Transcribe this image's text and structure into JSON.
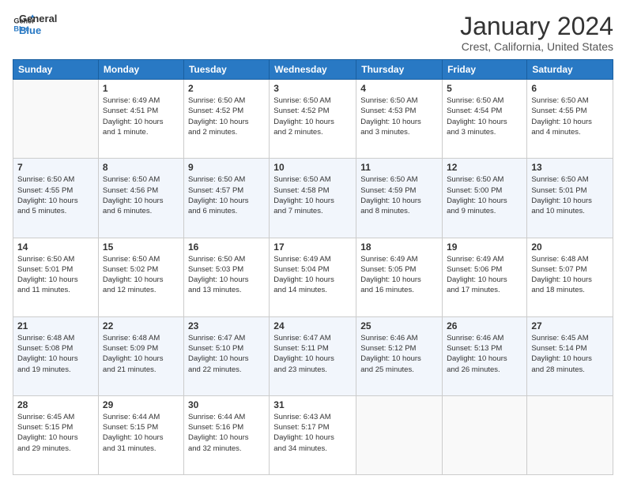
{
  "logo": {
    "line1": "General",
    "line2": "Blue"
  },
  "title": "January 2024",
  "location": "Crest, California, United States",
  "headers": [
    "Sunday",
    "Monday",
    "Tuesday",
    "Wednesday",
    "Thursday",
    "Friday",
    "Saturday"
  ],
  "rows": [
    [
      {
        "day": "",
        "info": ""
      },
      {
        "day": "1",
        "info": "Sunrise: 6:49 AM\nSunset: 4:51 PM\nDaylight: 10 hours\nand 1 minute."
      },
      {
        "day": "2",
        "info": "Sunrise: 6:50 AM\nSunset: 4:52 PM\nDaylight: 10 hours\nand 2 minutes."
      },
      {
        "day": "3",
        "info": "Sunrise: 6:50 AM\nSunset: 4:52 PM\nDaylight: 10 hours\nand 2 minutes."
      },
      {
        "day": "4",
        "info": "Sunrise: 6:50 AM\nSunset: 4:53 PM\nDaylight: 10 hours\nand 3 minutes."
      },
      {
        "day": "5",
        "info": "Sunrise: 6:50 AM\nSunset: 4:54 PM\nDaylight: 10 hours\nand 3 minutes."
      },
      {
        "day": "6",
        "info": "Sunrise: 6:50 AM\nSunset: 4:55 PM\nDaylight: 10 hours\nand 4 minutes."
      }
    ],
    [
      {
        "day": "7",
        "info": "Sunrise: 6:50 AM\nSunset: 4:55 PM\nDaylight: 10 hours\nand 5 minutes."
      },
      {
        "day": "8",
        "info": "Sunrise: 6:50 AM\nSunset: 4:56 PM\nDaylight: 10 hours\nand 6 minutes."
      },
      {
        "day": "9",
        "info": "Sunrise: 6:50 AM\nSunset: 4:57 PM\nDaylight: 10 hours\nand 6 minutes."
      },
      {
        "day": "10",
        "info": "Sunrise: 6:50 AM\nSunset: 4:58 PM\nDaylight: 10 hours\nand 7 minutes."
      },
      {
        "day": "11",
        "info": "Sunrise: 6:50 AM\nSunset: 4:59 PM\nDaylight: 10 hours\nand 8 minutes."
      },
      {
        "day": "12",
        "info": "Sunrise: 6:50 AM\nSunset: 5:00 PM\nDaylight: 10 hours\nand 9 minutes."
      },
      {
        "day": "13",
        "info": "Sunrise: 6:50 AM\nSunset: 5:01 PM\nDaylight: 10 hours\nand 10 minutes."
      }
    ],
    [
      {
        "day": "14",
        "info": "Sunrise: 6:50 AM\nSunset: 5:01 PM\nDaylight: 10 hours\nand 11 minutes."
      },
      {
        "day": "15",
        "info": "Sunrise: 6:50 AM\nSunset: 5:02 PM\nDaylight: 10 hours\nand 12 minutes."
      },
      {
        "day": "16",
        "info": "Sunrise: 6:50 AM\nSunset: 5:03 PM\nDaylight: 10 hours\nand 13 minutes."
      },
      {
        "day": "17",
        "info": "Sunrise: 6:49 AM\nSunset: 5:04 PM\nDaylight: 10 hours\nand 14 minutes."
      },
      {
        "day": "18",
        "info": "Sunrise: 6:49 AM\nSunset: 5:05 PM\nDaylight: 10 hours\nand 16 minutes."
      },
      {
        "day": "19",
        "info": "Sunrise: 6:49 AM\nSunset: 5:06 PM\nDaylight: 10 hours\nand 17 minutes."
      },
      {
        "day": "20",
        "info": "Sunrise: 6:48 AM\nSunset: 5:07 PM\nDaylight: 10 hours\nand 18 minutes."
      }
    ],
    [
      {
        "day": "21",
        "info": "Sunrise: 6:48 AM\nSunset: 5:08 PM\nDaylight: 10 hours\nand 19 minutes."
      },
      {
        "day": "22",
        "info": "Sunrise: 6:48 AM\nSunset: 5:09 PM\nDaylight: 10 hours\nand 21 minutes."
      },
      {
        "day": "23",
        "info": "Sunrise: 6:47 AM\nSunset: 5:10 PM\nDaylight: 10 hours\nand 22 minutes."
      },
      {
        "day": "24",
        "info": "Sunrise: 6:47 AM\nSunset: 5:11 PM\nDaylight: 10 hours\nand 23 minutes."
      },
      {
        "day": "25",
        "info": "Sunrise: 6:46 AM\nSunset: 5:12 PM\nDaylight: 10 hours\nand 25 minutes."
      },
      {
        "day": "26",
        "info": "Sunrise: 6:46 AM\nSunset: 5:13 PM\nDaylight: 10 hours\nand 26 minutes."
      },
      {
        "day": "27",
        "info": "Sunrise: 6:45 AM\nSunset: 5:14 PM\nDaylight: 10 hours\nand 28 minutes."
      }
    ],
    [
      {
        "day": "28",
        "info": "Sunrise: 6:45 AM\nSunset: 5:15 PM\nDaylight: 10 hours\nand 29 minutes."
      },
      {
        "day": "29",
        "info": "Sunrise: 6:44 AM\nSunset: 5:15 PM\nDaylight: 10 hours\nand 31 minutes."
      },
      {
        "day": "30",
        "info": "Sunrise: 6:44 AM\nSunset: 5:16 PM\nDaylight: 10 hours\nand 32 minutes."
      },
      {
        "day": "31",
        "info": "Sunrise: 6:43 AM\nSunset: 5:17 PM\nDaylight: 10 hours\nand 34 minutes."
      },
      {
        "day": "",
        "info": ""
      },
      {
        "day": "",
        "info": ""
      },
      {
        "day": "",
        "info": ""
      }
    ]
  ]
}
